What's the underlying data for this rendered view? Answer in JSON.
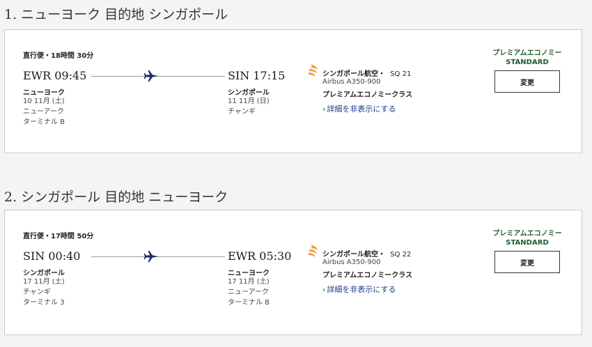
{
  "segments": [
    {
      "heading": "1. ニューヨーク 目的地 シンガポール",
      "duration": "直行便・18時間 30分",
      "departure": {
        "code_time": "EWR 09:45",
        "city": "ニューヨーク",
        "date": "10 11月 (土)",
        "airport": "ニューアーク",
        "terminal": "ターミナル B"
      },
      "arrival": {
        "code_time": "SIN 17:15",
        "city": "シンガポール",
        "date": "11 11月 (日)",
        "airport": "チャンギ",
        "terminal": ""
      },
      "airline": "シンガポール航空・",
      "flight_no": "SQ 21",
      "aircraft": "Airbus A350-900",
      "cabin": "プレミアムエコノミークラス",
      "details_link": "詳細を非表示にする",
      "fare_name": "プレミアムエコノミー",
      "fare_type": "STANDARD",
      "change_label": "変更"
    },
    {
      "heading": "2. シンガポール 目的地 ニューヨーク",
      "duration": "直行便・17時間 50分",
      "departure": {
        "code_time": "SIN 00:40",
        "city": "シンガポール",
        "date": "17 11月 (土)",
        "airport": "チャンギ",
        "terminal": "ターミナル 3"
      },
      "arrival": {
        "code_time": "EWR 05:30",
        "city": "ニューヨーク",
        "date": "17 11月 (土)",
        "airport": "ニューアーク",
        "terminal": "ターミナル B"
      },
      "airline": "シンガポール航空・",
      "flight_no": "SQ 22",
      "aircraft": "Airbus A350-900",
      "cabin": "プレミアムエコノミークラス",
      "details_link": "詳細を非表示にする",
      "fare_name": "プレミアムエコノミー",
      "fare_type": "STANDARD",
      "change_label": "変更"
    }
  ],
  "icons": {
    "plane": "airplane-icon",
    "chevron": "chevron-right-icon",
    "logo": "singapore-airlines-logo"
  },
  "colors": {
    "plane": "#1b2a6b",
    "fare": "#1f5c2a",
    "link": "#1b3a8a",
    "logo": "#e8a13a"
  }
}
